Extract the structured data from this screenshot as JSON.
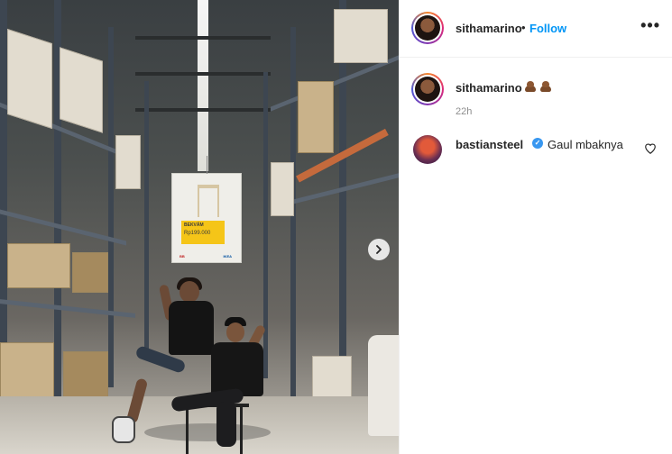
{
  "post": {
    "image": {
      "sign_product_name": "BEKVÄM",
      "sign_price": "Rp199.000",
      "sign_footer_left": "BB",
      "sign_footer_right": "IKEA"
    },
    "next_icon": "chevron-right-icon"
  },
  "header": {
    "username": "sithamarino",
    "separator": "•",
    "follow_label": "Follow",
    "more_icon": "more-horizontal-icon",
    "more_label": "•••"
  },
  "caption": {
    "username": "sithamarino",
    "emojis": [
      "pile-of-poo-emoji",
      "pile-of-poo-emoji"
    ],
    "time": "22h"
  },
  "comments": [
    {
      "username": "bastiansteel",
      "verified": true,
      "verified_icon": "verified-badge-icon",
      "text": "Gaul mbaknya",
      "like_icon": "heart-outline-icon"
    }
  ],
  "colors": {
    "link_blue": "#0095f6",
    "verified_blue": "#3897f0",
    "secondary_text": "#8e8e8e",
    "divider": "#efefef"
  }
}
